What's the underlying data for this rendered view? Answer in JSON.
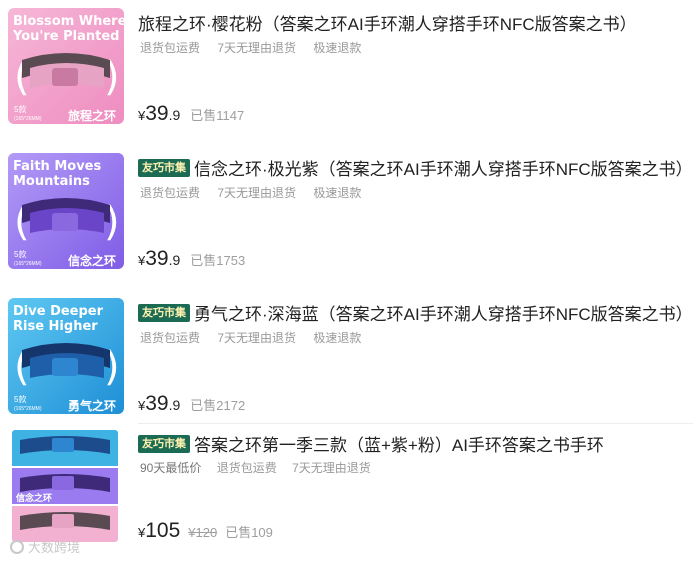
{
  "colors": {
    "badge_bg": "#1b6b54",
    "badge_text": "#fdf1b0",
    "pink_theme": "#ef9cc6",
    "purple_theme": "#9b7bf0",
    "blue_theme": "#2aa9e6"
  },
  "items": [
    {
      "thumb": {
        "headline_1": "Blossom Where",
        "headline_2": "You're Planted",
        "count": "5款",
        "size": "(165*26MM)",
        "name": "旅程之环"
      },
      "badge": "",
      "title": "旅程之环·樱花粉（答案之环AI手环潮人穿搭手环NFC版答案之书）",
      "tags": [
        "退货包运费",
        "7天无理由退货",
        "极速退款"
      ],
      "currency": "¥",
      "price_int": "39",
      "price_dec": ".9",
      "original_price": "",
      "sold": "已售1147"
    },
    {
      "thumb": {
        "headline_1": "Faith Moves",
        "headline_2": "Mountains",
        "count": "5款",
        "size": "(165*26MM)",
        "name": "信念之环"
      },
      "badge": "友巧市集",
      "title": "信念之环·极光紫（答案之环AI手环潮人穿搭手环NFC版答案之书）",
      "tags": [
        "退货包运费",
        "7天无理由退货",
        "极速退款"
      ],
      "currency": "¥",
      "price_int": "39",
      "price_dec": ".9",
      "original_price": "",
      "sold": "已售1753"
    },
    {
      "thumb": {
        "headline_1": "Dive Deeper",
        "headline_2": "Rise Higher",
        "count": "5款",
        "size": "(165*26MM)",
        "name": "勇气之环"
      },
      "badge": "友巧市集",
      "title": "勇气之环·深海蓝（答案之环AI手环潮人穿搭手环NFC版答案之书）",
      "tags": [
        "退货包运费",
        "7天无理由退货",
        "极速退款"
      ],
      "currency": "¥",
      "price_int": "39",
      "price_dec": ".9",
      "original_price": "",
      "sold": "已售2172"
    },
    {
      "thumb": {
        "name": "信念之环"
      },
      "badge": "友巧市集",
      "title": "答案之环第一季三款（蓝+紫+粉）AI手环答案之书手环",
      "tags": [
        "90天最低价",
        "退货包运费",
        "7天无理由退货"
      ],
      "currency": "¥",
      "price_int": "105",
      "price_dec": "",
      "original_price": "¥120",
      "sold": "已售109"
    }
  ],
  "watermark": "大数跨境"
}
